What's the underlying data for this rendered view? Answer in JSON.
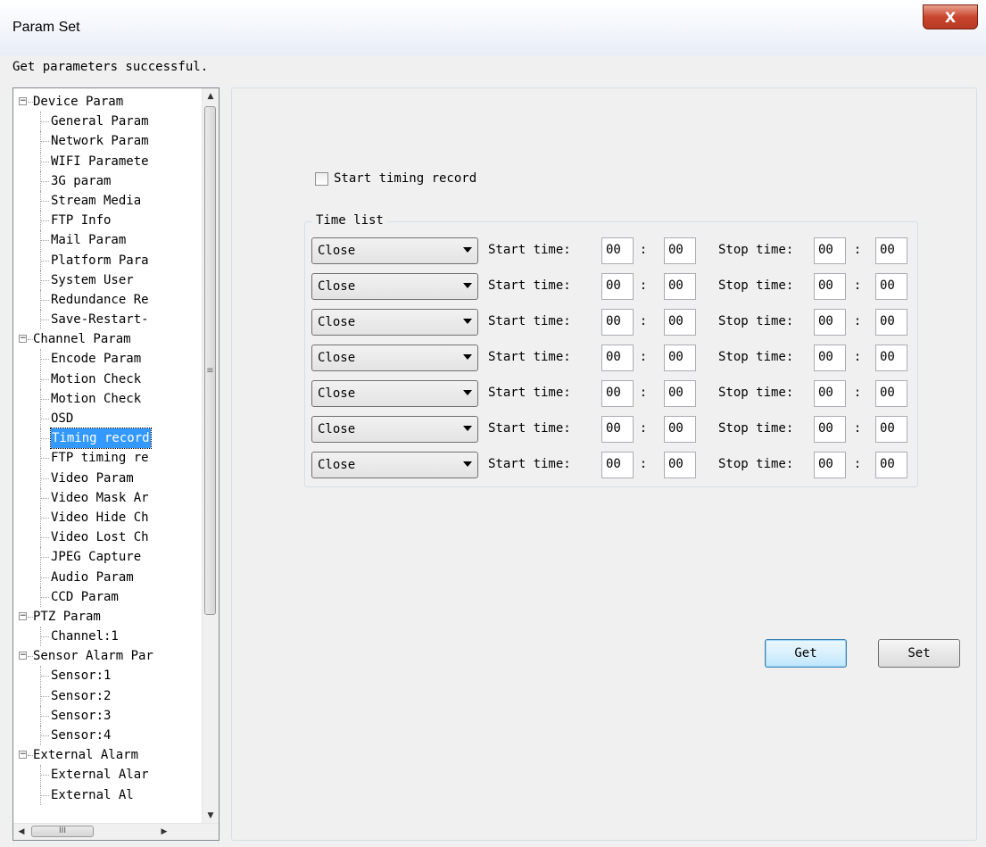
{
  "window": {
    "title": "Param Set",
    "close_label": "X"
  },
  "status": "Get parameters successful.",
  "tree": [
    {
      "label": "Device Param",
      "level": 0,
      "expander": "−"
    },
    {
      "label": "General Param",
      "level": 1
    },
    {
      "label": "Network Param",
      "level": 1
    },
    {
      "label": "WIFI Paramete",
      "level": 1
    },
    {
      "label": "3G param",
      "level": 1
    },
    {
      "label": "Stream Media",
      "level": 1
    },
    {
      "label": "FTP Info",
      "level": 1
    },
    {
      "label": "Mail Param",
      "level": 1
    },
    {
      "label": "Platform Para",
      "level": 1
    },
    {
      "label": "System User",
      "level": 1
    },
    {
      "label": "Redundance Re",
      "level": 1
    },
    {
      "label": "Save-Restart-",
      "level": 1
    },
    {
      "label": "Channel Param",
      "level": 0,
      "expander": "−"
    },
    {
      "label": "Encode Param",
      "level": 1
    },
    {
      "label": "Motion Check",
      "level": 1
    },
    {
      "label": "Motion Check",
      "level": 1
    },
    {
      "label": "OSD",
      "level": 1
    },
    {
      "label": "Timing record",
      "level": 1,
      "selected": true
    },
    {
      "label": "FTP timing re",
      "level": 1
    },
    {
      "label": "Video Param",
      "level": 1
    },
    {
      "label": "Video Mask Ar",
      "level": 1
    },
    {
      "label": "Video Hide Ch",
      "level": 1
    },
    {
      "label": "Video Lost Ch",
      "level": 1
    },
    {
      "label": "JPEG Capture",
      "level": 1
    },
    {
      "label": "Audio Param",
      "level": 1
    },
    {
      "label": "CCD Param",
      "level": 1
    },
    {
      "label": "PTZ Param",
      "level": 0,
      "expander": "−"
    },
    {
      "label": "Channel:1",
      "level": 1
    },
    {
      "label": "Sensor Alarm Par",
      "level": 0,
      "expander": "−"
    },
    {
      "label": "Sensor:1",
      "level": 1
    },
    {
      "label": "Sensor:2",
      "level": 1
    },
    {
      "label": "Sensor:3",
      "level": 1
    },
    {
      "label": "Sensor:4",
      "level": 1
    },
    {
      "label": "External Alarm",
      "level": 0,
      "expander": "−"
    },
    {
      "label": "External Alar",
      "level": 1
    },
    {
      "label": "External Al",
      "level": 1
    }
  ],
  "scroll": {
    "up": "▲",
    "down": "▼",
    "left": "◀",
    "right": "▶",
    "grip_h": "III",
    "grip_v": "≡"
  },
  "timing": {
    "checkbox_label": "Start timing record",
    "checked": false,
    "group_title": "Time list",
    "start_label": "Start time:",
    "stop_label": "Stop time:",
    "colon": ":",
    "rows": [
      {
        "mode": "Close",
        "start_h": "00",
        "start_m": "00",
        "stop_h": "00",
        "stop_m": "00"
      },
      {
        "mode": "Close",
        "start_h": "00",
        "start_m": "00",
        "stop_h": "00",
        "stop_m": "00"
      },
      {
        "mode": "Close",
        "start_h": "00",
        "start_m": "00",
        "stop_h": "00",
        "stop_m": "00"
      },
      {
        "mode": "Close",
        "start_h": "00",
        "start_m": "00",
        "stop_h": "00",
        "stop_m": "00"
      },
      {
        "mode": "Close",
        "start_h": "00",
        "start_m": "00",
        "stop_h": "00",
        "stop_m": "00"
      },
      {
        "mode": "Close",
        "start_h": "00",
        "start_m": "00",
        "stop_h": "00",
        "stop_m": "00"
      },
      {
        "mode": "Close",
        "start_h": "00",
        "start_m": "00",
        "stop_h": "00",
        "stop_m": "00"
      }
    ]
  },
  "buttons": {
    "get": "Get",
    "set": "Set"
  }
}
